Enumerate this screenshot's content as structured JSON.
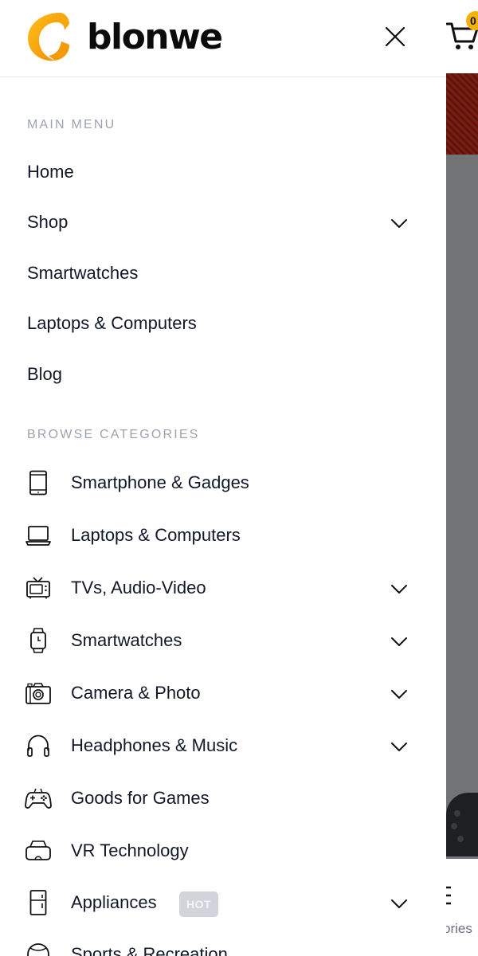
{
  "brand": {
    "name": "blonwe",
    "accent": "#f5a70b"
  },
  "header": {
    "close_icon": "close-icon"
  },
  "background_page": {
    "cart_count": "0",
    "bottom_nav_partial_label": "ories"
  },
  "main_menu": {
    "title": "MAIN MENU",
    "items": [
      {
        "label": "Home",
        "has_submenu": false
      },
      {
        "label": "Shop",
        "has_submenu": true
      },
      {
        "label": "Smartwatches",
        "has_submenu": false
      },
      {
        "label": "Laptops & Computers",
        "has_submenu": false
      },
      {
        "label": "Blog",
        "has_submenu": false
      }
    ]
  },
  "categories": {
    "title": "BROWSE CATEGORIES",
    "items": [
      {
        "label": "Smartphone & Gadges",
        "icon": "smartphone-icon",
        "has_submenu": false
      },
      {
        "label": "Laptops & Computers",
        "icon": "laptop-icon",
        "has_submenu": false
      },
      {
        "label": "TVs, Audio-Video",
        "icon": "tv-icon",
        "has_submenu": true
      },
      {
        "label": "Smartwatches",
        "icon": "smartwatch-icon",
        "has_submenu": true
      },
      {
        "label": "Camera & Photo",
        "icon": "camera-icon",
        "has_submenu": true
      },
      {
        "label": "Headphones & Music",
        "icon": "headphones-icon",
        "has_submenu": true
      },
      {
        "label": "Goods for Games",
        "icon": "gamepad-icon",
        "has_submenu": false
      },
      {
        "label": "VR Technology",
        "icon": "vr-headset-icon",
        "has_submenu": false
      },
      {
        "label": "Appliances",
        "icon": "fridge-icon",
        "has_submenu": true,
        "badge": "HOT"
      },
      {
        "label": "Sports & Recreation",
        "icon": "sports-icon",
        "has_submenu": false
      }
    ]
  }
}
